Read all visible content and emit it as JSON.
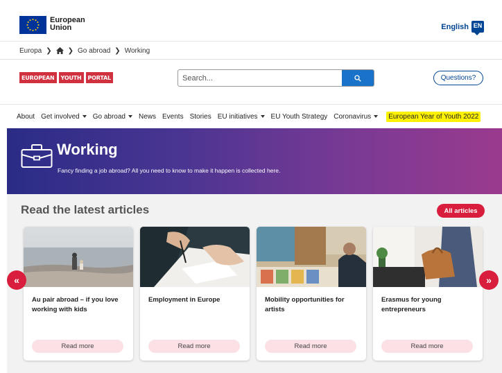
{
  "eu": {
    "name_line1": "European",
    "name_line2": "Union"
  },
  "language": {
    "label": "English",
    "code": "EN"
  },
  "breadcrumb": {
    "root": "Europa",
    "section": "Go abroad",
    "current": "Working"
  },
  "logo": {
    "words": [
      "EUROPEAN",
      "YOUTH",
      "PORTAL"
    ]
  },
  "search": {
    "placeholder": "Search..."
  },
  "questions": {
    "label": "Questions?"
  },
  "nav": {
    "items": [
      "About",
      "Get involved",
      "Go abroad",
      "News",
      "Events",
      "Stories",
      "EU initiatives",
      "EU Youth Strategy",
      "Coronavirus"
    ],
    "highlight": "European Year of Youth 2022"
  },
  "hero": {
    "title": "Working",
    "subtitle": "Fancy finding a job abroad? All you need to know to make it happen is collected here."
  },
  "articles": {
    "heading": "Read the latest articles",
    "all_label": "All articles",
    "cards": [
      {
        "title": "Au pair abroad – if you love working with kids",
        "cta": "Read more"
      },
      {
        "title": "Employment in Europe",
        "cta": "Read more"
      },
      {
        "title": "Mobility opportunities for artists",
        "cta": "Read more"
      },
      {
        "title": "Erasmus for young entrepreneurs",
        "cta": "Read more"
      }
    ],
    "prev_label": "«",
    "next_label": "»"
  },
  "colors": {
    "eu_blue": "#003399",
    "brand_red": "#d1313f",
    "accent_red": "#d81e3c",
    "link_blue": "#004494",
    "search_blue": "#1a73c8",
    "highlight_yellow": "#fff200",
    "hero_gradient_start": "#2a2c86",
    "hero_gradient_end": "#9a3a8e"
  }
}
